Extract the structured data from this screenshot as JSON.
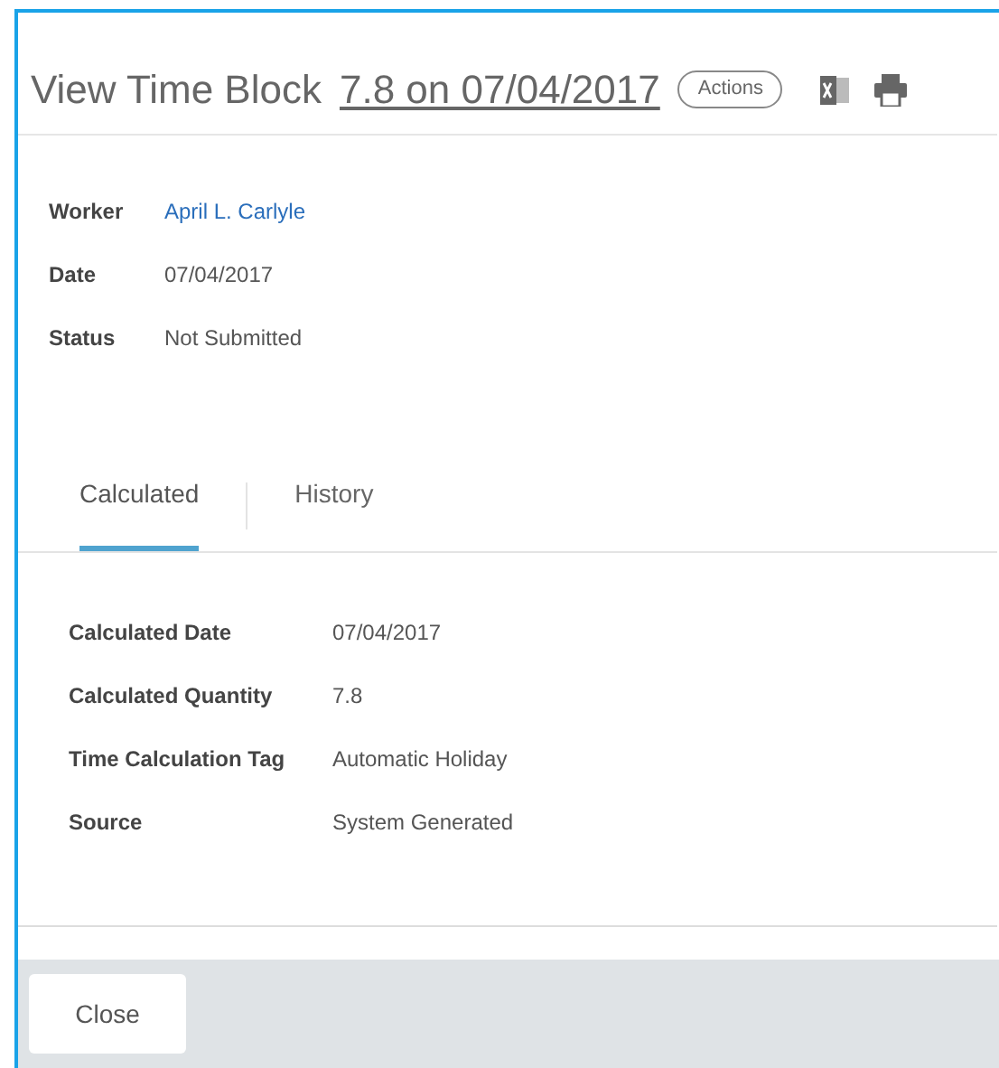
{
  "header": {
    "title": "View Time Block",
    "subject": "7.8 on 07/04/2017",
    "actions_button": "Actions"
  },
  "fields": [
    {
      "label": "Worker",
      "value": "April L. Carlyle",
      "kind": "link"
    },
    {
      "label": "Date",
      "value": "07/04/2017",
      "kind": "text"
    },
    {
      "label": "Status",
      "value": "Not Submitted",
      "kind": "text"
    }
  ],
  "tabs": [
    {
      "label": "Calculated",
      "selected": true
    },
    {
      "label": "History",
      "selected": false
    }
  ],
  "details": [
    {
      "label": "Calculated Date",
      "value": "07/04/2017"
    },
    {
      "label": "Calculated Quantity",
      "value": "7.8"
    },
    {
      "label": "Time Calculation Tag",
      "value": "Automatic Holiday"
    },
    {
      "label": "Source",
      "value": "System Generated"
    }
  ],
  "footer": {
    "close_button": "Close"
  }
}
